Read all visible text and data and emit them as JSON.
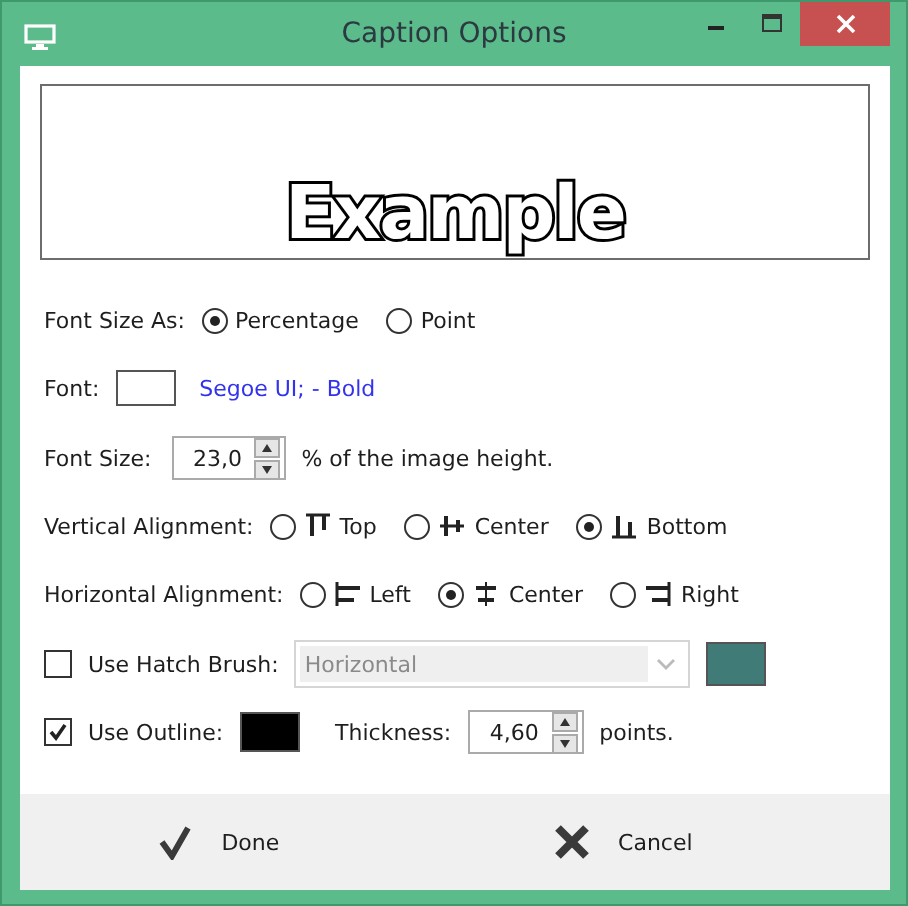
{
  "window": {
    "title": "Caption Options"
  },
  "preview": {
    "text": "Example"
  },
  "font_size_as": {
    "label": "Font Size As:",
    "options": [
      {
        "label": "Percentage",
        "selected": true
      },
      {
        "label": "Point",
        "selected": false
      }
    ]
  },
  "font": {
    "label": "Font:",
    "color": "#ffffff",
    "value": "Segoe UI;  - Bold"
  },
  "font_size": {
    "label": "Font Size:",
    "value": "23,0",
    "suffix": "% of the image height."
  },
  "vertical_alignment": {
    "label": "Vertical Alignment:",
    "options": [
      {
        "label": "Top",
        "kind": "top",
        "selected": false
      },
      {
        "label": "Center",
        "kind": "middle",
        "selected": false
      },
      {
        "label": "Bottom",
        "kind": "bottom",
        "selected": true
      }
    ]
  },
  "horizontal_alignment": {
    "label": "Horizontal Alignment:",
    "options": [
      {
        "label": "Left",
        "kind": "left",
        "selected": false
      },
      {
        "label": "Center",
        "kind": "center",
        "selected": true
      },
      {
        "label": "Right",
        "kind": "right",
        "selected": false
      }
    ]
  },
  "hatch": {
    "label": "Use Hatch Brush:",
    "checked": false,
    "value": "Horizontal",
    "disabled": true,
    "color": "#417b78"
  },
  "outline": {
    "label": "Use Outline:",
    "checked": true,
    "color": "#000000",
    "thickness_label": "Thickness:",
    "thickness": "4,60",
    "unit": "points."
  },
  "buttons": [
    {
      "label": "Done",
      "kind": "done"
    },
    {
      "label": "Cancel",
      "kind": "cancel"
    }
  ]
}
